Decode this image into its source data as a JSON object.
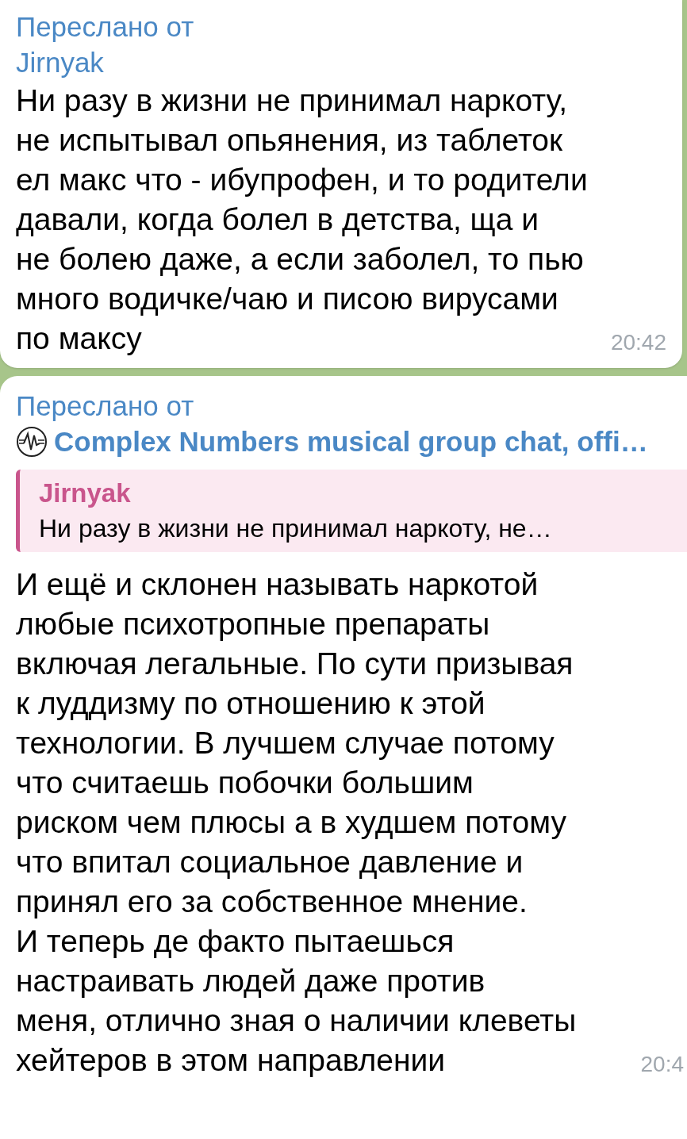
{
  "messages": [
    {
      "forwarded_label": "Переслано от",
      "forwarded_from": "Jirnyak",
      "has_avatar": false,
      "text": "Ни разу в жизни не принимал наркоту,\nне испытывал опьянения, из таблеток\nел макс что - ибупрофен, и то родители\nдавали, когда болел в детства, ща и\nне болею даже, а если заболел, то пью\nмного водичке/чаю и писою вирусами\nпо максу",
      "time": "20:42"
    },
    {
      "forwarded_label": "Переслано от",
      "forwarded_from": "Complex Numbers musical group chat, offi…",
      "has_avatar": true,
      "reply": {
        "author": "Jirnyak",
        "text": "Ни разу в жизни не принимал наркоту, не…"
      },
      "text": "И ещё и склонен называть наркотой\nлюбые психотропные препараты\nвключая легальные. По сути призывая\nк луддизму по отношению к этой\nтехнологии. В лучшем случае потому\nчто считаешь побочки большим\nриском чем плюсы а в худшем потому\nчто впитал социальное давление и\nпринял его за собственное мнение.\nИ теперь де факто пытаешься\nнастраивать людей даже против\nменя, отлично зная о наличии клеветы\nхейтеров в этом направлении",
      "time": "20:4"
    }
  ]
}
